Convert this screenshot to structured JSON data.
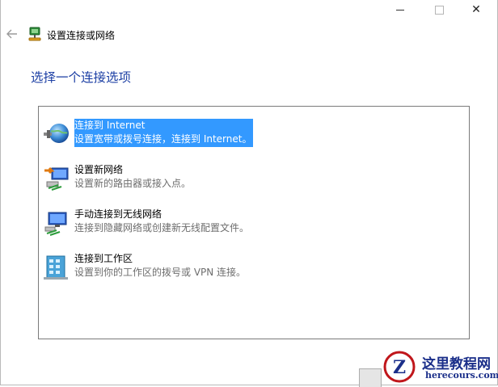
{
  "window": {
    "title": "设置连接或网络",
    "caption": {
      "minimize_icon": "minimize-icon",
      "maximize_icon": "maximize-icon",
      "close_icon": "close-icon",
      "close_glyph": "✕"
    }
  },
  "nav": {
    "back_icon": "back-arrow-icon"
  },
  "heading": "选择一个连接选项",
  "options": [
    {
      "title": "连接到 Internet",
      "description": "设置宽带或拨号连接，连接到 Internet。",
      "icon": "globe-icon",
      "selected": true
    },
    {
      "title": "设置新网络",
      "description": "设置新的路由器或接入点。",
      "icon": "new-network-icon",
      "selected": false
    },
    {
      "title": "手动连接到无线网络",
      "description": "连接到隐藏网络或创建新无线配置文件。",
      "icon": "wireless-network-icon",
      "selected": false
    },
    {
      "title": "连接到工作区",
      "description": "设置到你的工作区的拨号或 VPN 连接。",
      "icon": "workplace-icon",
      "selected": false
    }
  ],
  "colors": {
    "heading": "#1c3fa4",
    "selection": "#3399ff",
    "description": "#6d6d6d"
  },
  "watermark": {
    "name": "这里教程网",
    "url": "herecours.com",
    "logo_letter": "Z"
  }
}
